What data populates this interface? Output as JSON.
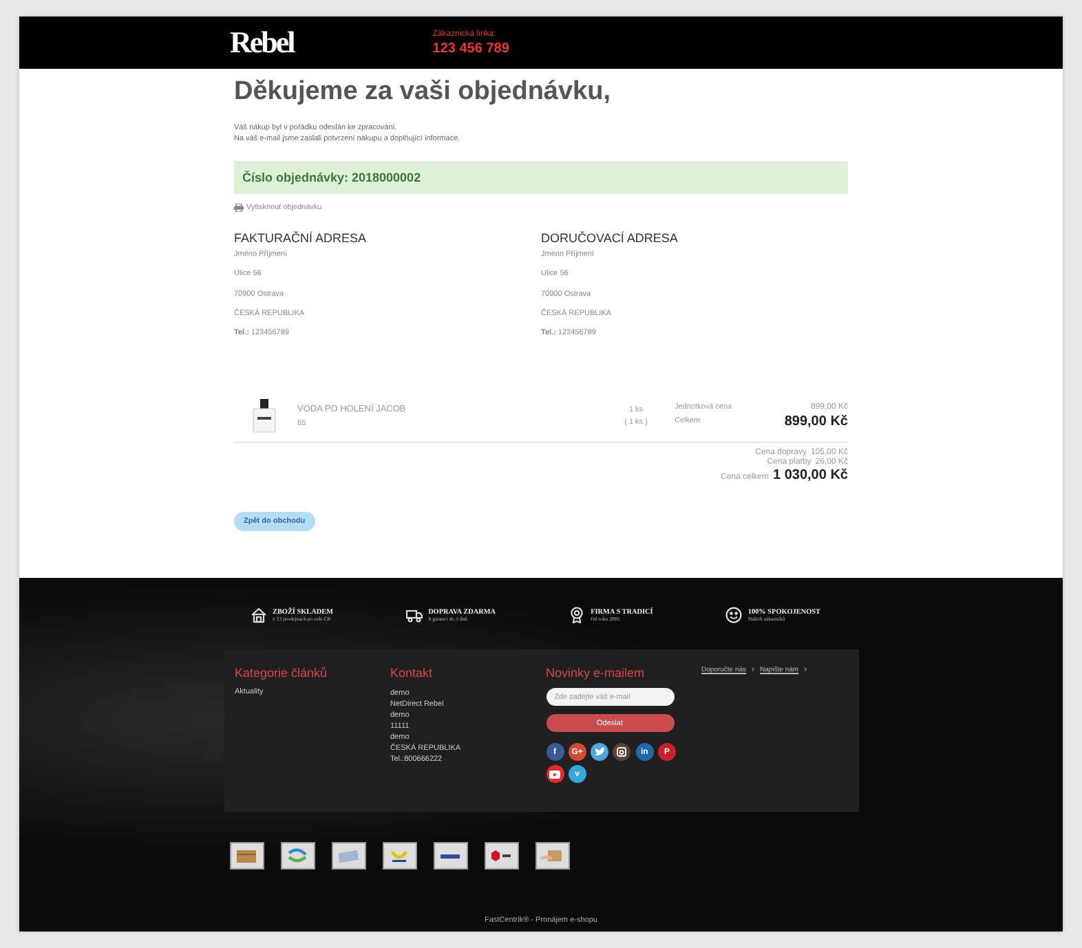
{
  "header": {
    "logo": "Rebel",
    "hotline_label": "Zákaznická linka:",
    "hotline_number": "123 456 789"
  },
  "title": "Děkujeme za vaši objednávku,",
  "intro": [
    "Váš nákup byl v pořádku odeslán ke zpracování.",
    "Na váš e-mail jsme zaslali potvrzení nákupu a doplňující informace."
  ],
  "order_number": "Číslo objednávky: 2018000002",
  "print_link": "Vytisknout objednávku",
  "addresses": [
    {
      "heading": "FAKTURAČNÍ ADRESA",
      "lines": [
        "Jméno Příjmení",
        "Ulice 56",
        "70900 Ostrava",
        "ČESKÁ REPUBLIKA"
      ],
      "phone": "**Tel.:** 123456789"
    },
    {
      "heading": "DORUČOVACÍ ADRESA",
      "lines": [
        "Jméno Příjmení",
        "Ulice 56",
        "70900 Ostrava",
        "ČESKÁ REPUBLIKA"
      ],
      "phone": "**Tel.:** 123456789"
    }
  ],
  "items": [
    {
      "name": "VODA PO HOLENÍ JACOB",
      "code": "65",
      "qty": "1 ks",
      "qty_sub": "( 1 ks )",
      "unit_label": "Jednotková cena",
      "unit_price": "899,00 Kč",
      "total_label": "Celkem",
      "total": "899,00 Kč"
    }
  ],
  "summary": [
    {
      "label": "Cena dopravy",
      "value": "105,00 Kč",
      "kind": "normal"
    },
    {
      "label": "Cena platby",
      "value": "26,00 Kč",
      "kind": "normal"
    },
    {
      "label": "Cena celkem",
      "value": "1 030,00 Kč",
      "kind": "grand"
    }
  ],
  "back_button": {
    "label": "Zpět do obchodu",
    "disabled": true
  },
  "features": [
    {
      "kind": "house",
      "title": "ZBOŽÍ SKLADEM",
      "subtitle": "v 13 prodejnách po celé ČR"
    },
    {
      "kind": "truck",
      "title": "DOPRAVA ZDARMA",
      "subtitle": "S garancí do 3 dnů"
    },
    {
      "kind": "medal",
      "title": "FIRMA S TRADICÍ",
      "subtitle": "Od roku 2005"
    },
    {
      "kind": "smile",
      "title": "100% SPOKOJENOST",
      "subtitle": "Našich zákazníků"
    }
  ],
  "footer": {
    "categories": {
      "heading": "Kategorie článků",
      "items": [
        "Aktuality"
      ]
    },
    "contact": {
      "heading": "Kontakt",
      "lines": [
        "demo",
        "NetDirect Rebel",
        "demo",
        "11111",
        "demo",
        "ČESKÁ REPUBLIKA",
        "Tel.:800666222"
      ]
    },
    "newsletter": {
      "heading": "Novinky e-mailem",
      "placeholder": "Zde zadejte váš e-mail",
      "button": "Odeslat"
    },
    "links": [
      "Doporučte nás",
      "Napište nám"
    ],
    "link_separator": "›",
    "social": [
      {
        "kind": "glyph",
        "glyph": "f",
        "color": "#3b5998"
      },
      {
        "kind": "glyph",
        "glyph": "G+",
        "color": "#d34836"
      },
      {
        "kind": "twitter",
        "color": "#4da7de"
      },
      {
        "kind": "instagram",
        "color": "#5b4336"
      },
      {
        "kind": "glyph",
        "glyph": "in",
        "color": "#1f69a8"
      },
      {
        "kind": "glyph",
        "glyph": "P",
        "color": "#cb2027"
      },
      {
        "kind": "youtube",
        "color": "#e52d27"
      },
      {
        "kind": "glyph",
        "glyph": "v",
        "color": "#35a6dc"
      }
    ],
    "carriers": [
      {
        "kind": "box"
      },
      {
        "kind": "arrows"
      },
      {
        "kind": "envelope"
      },
      {
        "kind": "posthorn"
      },
      {
        "kind": "ppl"
      },
      {
        "kind": "dpd"
      },
      {
        "kind": "hand"
      }
    ],
    "credit": "FastCentrik® - Pronájem e-shopu"
  }
}
